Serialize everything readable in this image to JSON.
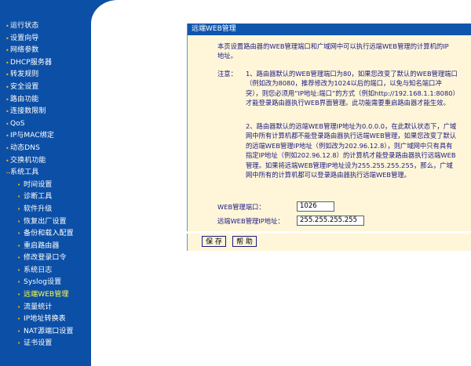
{
  "sidebar": {
    "items": [
      {
        "label": "运行状态"
      },
      {
        "label": "设置向导"
      },
      {
        "label": "网络参数"
      },
      {
        "label": "DHCP服务器"
      },
      {
        "label": "转发规则"
      },
      {
        "label": "安全设置"
      },
      {
        "label": "路由功能"
      },
      {
        "label": "连接数限制"
      },
      {
        "label": "QoS"
      },
      {
        "label": "IP与MAC绑定"
      },
      {
        "label": "动态DNS"
      },
      {
        "label": "交换机功能"
      },
      {
        "label": "系统工具"
      }
    ],
    "subitems": [
      {
        "label": "时间设置"
      },
      {
        "label": "诊断工具"
      },
      {
        "label": "软件升级"
      },
      {
        "label": "恢复出厂设置"
      },
      {
        "label": "备份和载入配置"
      },
      {
        "label": "重启路由器"
      },
      {
        "label": "修改登录口令"
      },
      {
        "label": "系统日志"
      },
      {
        "label": "Syslog设置"
      },
      {
        "label": "远端WEB管理"
      },
      {
        "label": "流量统计"
      },
      {
        "label": "IP地址转换表"
      },
      {
        "label": "NAT源端口设置"
      },
      {
        "label": "证书设置"
      }
    ],
    "bullet": "•",
    "open_bullet": "−"
  },
  "panel": {
    "title": "远端WEB管理",
    "intro": "本页设置路由器的WEB管理端口和广域网中可以执行远端WEB管理的计算机的IP地址。",
    "note_label": "注意：",
    "note1": "1、路由器默认的WEB管理端口为80，如果您改变了默认的WEB管理端口（例如改为8080，推荐修改为1024以后的端口，以免与知名端口冲突），则您必须用“IP地址:端口”的方式（例如http://192.168.1.1:8080）才能登录路由器执行WEB界面管理。此功能需要重启路由器才能生效。",
    "note2": "2、路由器默认的远端WEB管理IP地址为0.0.0.0，在此默认状态下，广域网中所有计算机都不能登录路由器执行远端WEB管理，如果您改变了默认的远端WEB管理IP地址（例如改为202.96.12.8），则广域网中只有具有指定IP地址（例如202.96.12.8）的计算机才能登录路由器执行远端WEB管理。如果将远端WEB管理IP地址设为255.255.255.255，那么，广域网中所有的计算机都可以登录路由器执行远端WEB管理。",
    "port_label": "WEB管理端口：",
    "port_value": "1026",
    "ip_label": "远端WEB管理IP地址：",
    "ip_value": "255.255.255.255"
  },
  "buttons": {
    "save": "保 存",
    "help": "帮 助"
  },
  "colors": {
    "sidebar": "#0c4fa6",
    "panel_bg": "#fff6d9",
    "title_bar": "#1055ad",
    "bullet": "#ffb400",
    "active_item": "#ffff4d"
  }
}
